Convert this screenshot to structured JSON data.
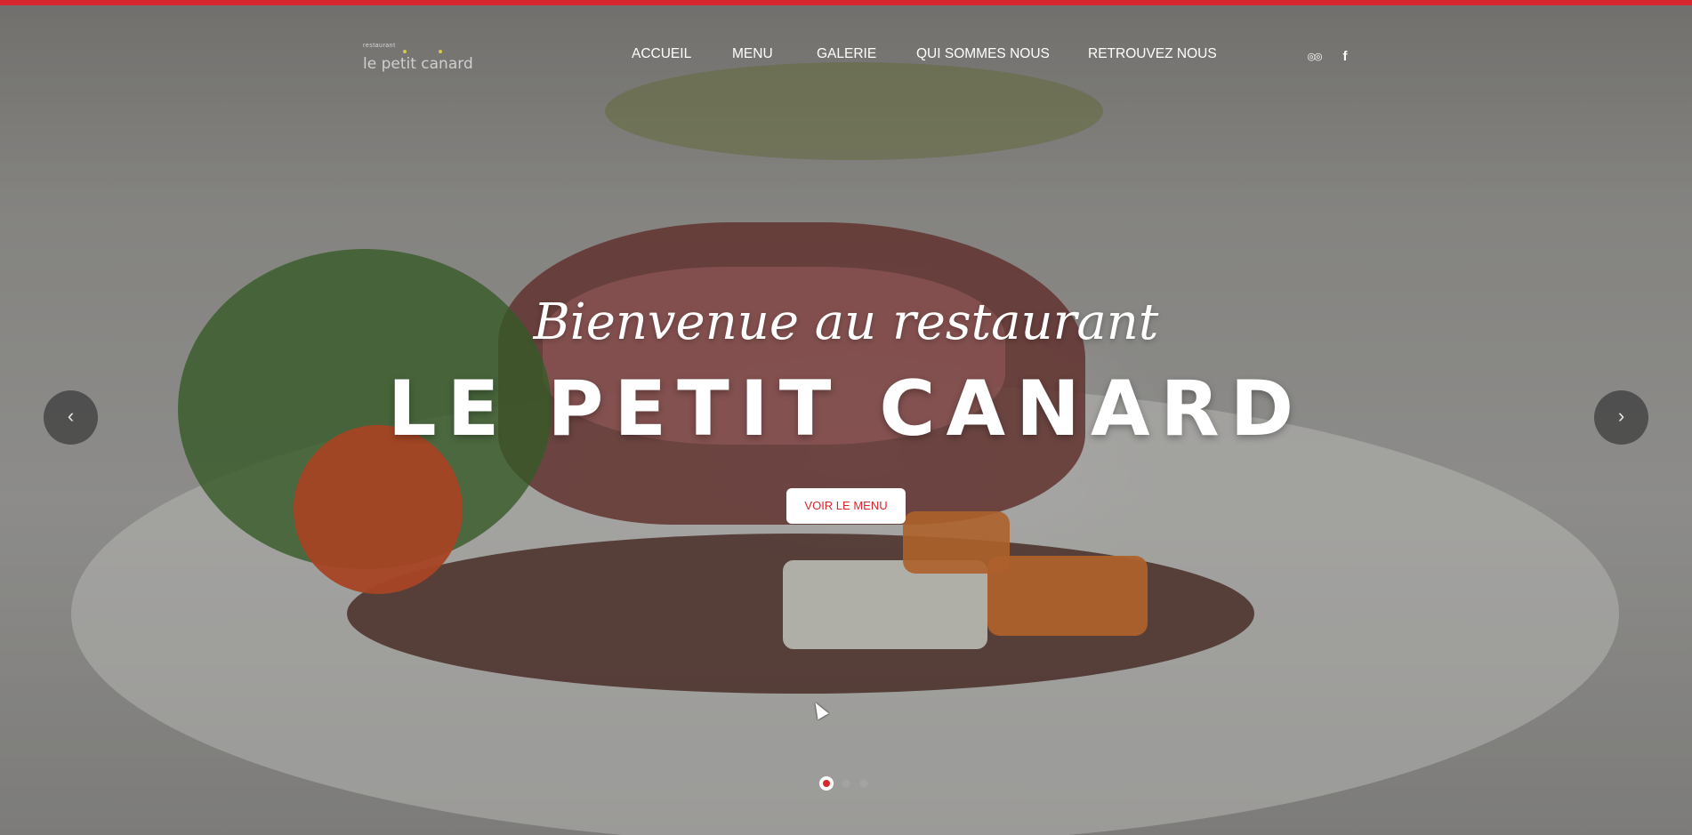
{
  "logo": {
    "small_text": "restaurant",
    "name": "le petit canard"
  },
  "nav": {
    "items": [
      {
        "label": "ACCUEIL"
      },
      {
        "label": "MENU"
      },
      {
        "label": "GALERIE"
      },
      {
        "label": "QUI SOMMES NOUS"
      },
      {
        "label": "RETROUVEZ NOUS"
      }
    ]
  },
  "social": {
    "tripadvisor_icon": "tripadvisor-icon",
    "facebook_icon": "facebook-icon",
    "tripadvisor_glyph": "◎◎",
    "facebook_glyph": "f"
  },
  "hero": {
    "welcome": "Bienvenue au restaurant",
    "title": "LE PETIT CANARD",
    "cta": "VOIR LE MENU"
  },
  "slider": {
    "prev": "‹",
    "next": "›",
    "slide_count": 3,
    "active_slide": 1
  },
  "colors": {
    "accent": "#d7262e",
    "text": "#ffffff"
  }
}
